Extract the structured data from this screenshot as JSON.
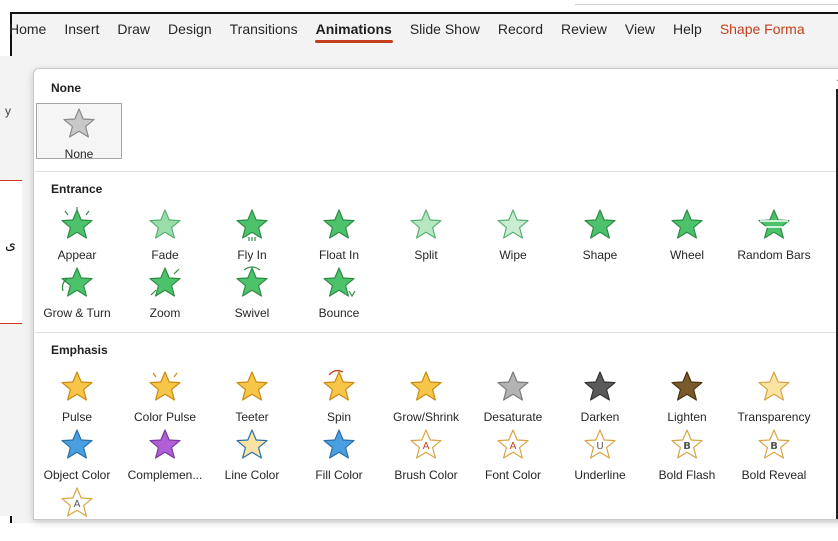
{
  "ribbon": {
    "tabs": [
      "Home",
      "Insert",
      "Draw",
      "Design",
      "Transitions",
      "Animations",
      "Slide Show",
      "Record",
      "Review",
      "View",
      "Help",
      "Shape Forma"
    ],
    "active_tab": "Animations"
  },
  "side_text": {
    "char": "ی",
    "glyph": "y"
  },
  "gallery": {
    "none": {
      "header": "None",
      "items": [
        {
          "label": "None",
          "icon": "star-gray-icon"
        }
      ]
    },
    "entrance": {
      "header": "Entrance",
      "items": [
        {
          "label": "Appear",
          "icon": "star-green-burst-icon"
        },
        {
          "label": "Fade",
          "icon": "star-green-fade-icon"
        },
        {
          "label": "Fly In",
          "icon": "star-green-fly-icon"
        },
        {
          "label": "Float In",
          "icon": "star-green-float-icon"
        },
        {
          "label": "Split",
          "icon": "star-green-split-icon"
        },
        {
          "label": "Wipe",
          "icon": "star-green-wipe-icon"
        },
        {
          "label": "Shape",
          "icon": "star-green-shape-icon"
        },
        {
          "label": "Wheel",
          "icon": "star-green-wheel-icon"
        },
        {
          "label": "Random Bars",
          "icon": "star-green-bars-icon"
        },
        {
          "label": "Grow & Turn",
          "icon": "star-green-grow-icon"
        },
        {
          "label": "Zoom",
          "icon": "star-green-zoom-icon"
        },
        {
          "label": "Swivel",
          "icon": "star-green-swivel-icon"
        },
        {
          "label": "Bounce",
          "icon": "star-green-bounce-icon"
        }
      ]
    },
    "emphasis": {
      "header": "Emphasis",
      "items": [
        {
          "label": "Pulse",
          "icon": "star-yellow-pulse-icon"
        },
        {
          "label": "Color Pulse",
          "icon": "star-yellow-colorpulse-icon"
        },
        {
          "label": "Teeter",
          "icon": "star-yellow-teeter-icon"
        },
        {
          "label": "Spin",
          "icon": "star-yellow-spin-icon"
        },
        {
          "label": "Grow/Shrink",
          "icon": "star-yellow-grow-icon"
        },
        {
          "label": "Desaturate",
          "icon": "star-gray-desaturate-icon"
        },
        {
          "label": "Darken",
          "icon": "star-dark-icon"
        },
        {
          "label": "Lighten",
          "icon": "star-brown-lighten-icon"
        },
        {
          "label": "Transparency",
          "icon": "star-light-transparency-icon"
        },
        {
          "label": "Object Color",
          "icon": "star-blue-object-icon"
        },
        {
          "label": "Complemen...",
          "icon": "star-purple-complement-icon"
        },
        {
          "label": "Line Color",
          "icon": "star-line-color-icon"
        },
        {
          "label": "Fill Color",
          "icon": "star-fill-color-icon"
        },
        {
          "label": "Brush Color",
          "icon": "star-brush-color-icon"
        },
        {
          "label": "Font Color",
          "icon": "star-font-color-icon"
        },
        {
          "label": "Underline",
          "icon": "star-underline-icon"
        },
        {
          "label": "Bold Flash",
          "icon": "star-bold-flash-icon"
        },
        {
          "label": "Bold Reveal",
          "icon": "star-bold-reveal-icon"
        },
        {
          "label": "",
          "icon": "star-wave-icon"
        }
      ]
    }
  },
  "colors": {
    "accent": "#c43e1c",
    "green": "#3cb55e",
    "yellow": "#f5b935",
    "gray": "#a0a0a0"
  }
}
